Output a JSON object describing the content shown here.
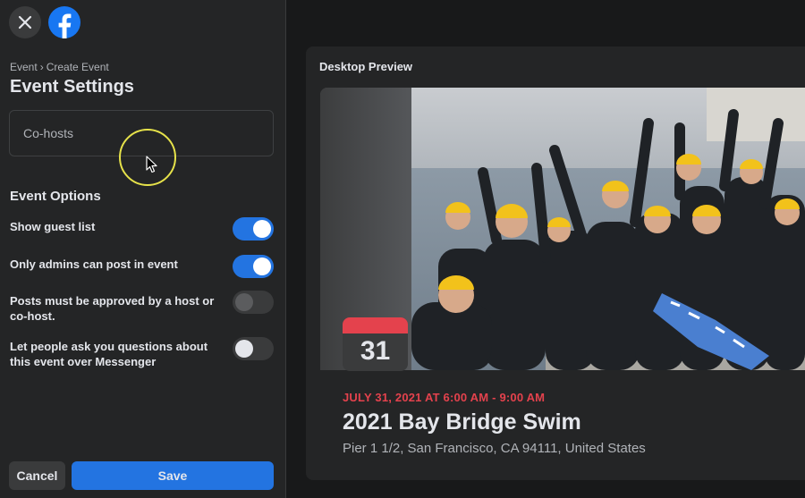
{
  "header": {
    "close_icon": "close-icon",
    "logo_icon": "facebook-logo"
  },
  "breadcrumb": {
    "parent": "Event",
    "separator": "›",
    "current": "Create Event"
  },
  "page_title": "Event Settings",
  "cohosts_field": {
    "placeholder": "Co-hosts",
    "value": ""
  },
  "event_options": {
    "heading": "Event Options",
    "items": [
      {
        "label": "Show guest list",
        "enabled": true
      },
      {
        "label": "Only admins can post in event",
        "enabled": true
      },
      {
        "label": "Posts must be approved by a host or co-host.",
        "enabled": false
      },
      {
        "label": "Let people ask you questions about this event over Messenger",
        "enabled": false
      }
    ]
  },
  "footer": {
    "cancel_label": "Cancel",
    "save_label": "Save"
  },
  "preview": {
    "label": "Desktop Preview",
    "calendar_day": "31",
    "date_line": "JULY 31, 2021 AT 6:00 AM - 9:00 AM",
    "event_title": "2021 Bay Bridge Swim",
    "location": "Pier 1 1/2, San Francisco, CA 94111, United States",
    "cover_image": "group of swimmers in wetsuits and yellow caps on a boat"
  },
  "colors": {
    "accent": "#2374e1",
    "date_red": "#e4424d",
    "panel": "#242526",
    "background": "#18191a"
  }
}
